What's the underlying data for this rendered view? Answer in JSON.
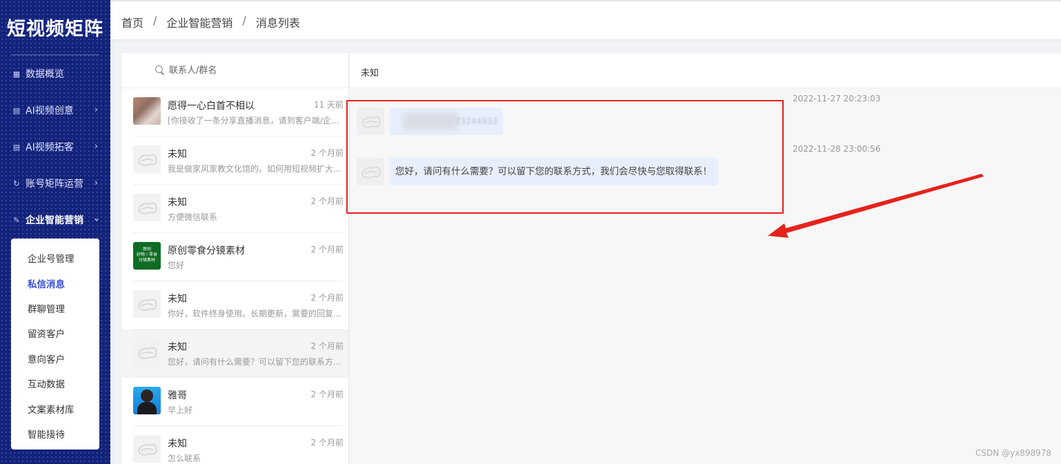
{
  "app": {
    "logo": "短视频矩阵"
  },
  "sidebar": {
    "items": [
      {
        "label": "数据概览",
        "icon": "dashboard-icon",
        "has_children": false
      },
      {
        "label": "AI视频创意",
        "icon": "video-icon",
        "has_children": true
      },
      {
        "label": "AI视频拓客",
        "icon": "video-icon",
        "has_children": true
      },
      {
        "label": "账号矩阵运营",
        "icon": "refresh-icon",
        "has_children": true
      },
      {
        "label": "企业智能营销",
        "icon": "pen-icon",
        "has_children": true,
        "expanded": true
      }
    ],
    "submenu": [
      {
        "label": "企业号管理"
      },
      {
        "label": "私信消息",
        "active": true
      },
      {
        "label": "群聊管理"
      },
      {
        "label": "留资客户"
      },
      {
        "label": "意向客户"
      },
      {
        "label": "互动数据"
      },
      {
        "label": "文案素材库"
      },
      {
        "label": "智能接待"
      }
    ]
  },
  "breadcrumb": [
    "首页",
    "企业智能营销",
    "消息列表"
  ],
  "search": {
    "placeholder": "联系人/群名"
  },
  "contacts": [
    {
      "name": "愿得一心白首不相以",
      "time": "11 天前",
      "preview": "[你接收了一条分享直播消息，请到客户端/企业...",
      "avatar": "photo"
    },
    {
      "name": "未知",
      "time": "2 个月前",
      "preview": "我是做家风家教文化馆的。如何用短视频扩大...",
      "avatar": "default"
    },
    {
      "name": "未知",
      "time": "2 个月前",
      "preview": "方便微信联系",
      "avatar": "default"
    },
    {
      "name": "原创零食分镜素材",
      "time": "2 个月前",
      "preview": "您好",
      "avatar": "green",
      "avatar_text": [
        "原创",
        "好物丨零食",
        "分镜素材"
      ]
    },
    {
      "name": "未知",
      "time": "2 个月前",
      "preview": "你好，软件终身使用。长期更新，需要的回复...",
      "avatar": "default"
    },
    {
      "name": "未知",
      "time": "2 个月前",
      "preview": "您好，请问有什么需要？可以留下您的联系方...",
      "avatar": "default",
      "selected": true
    },
    {
      "name": "雅哥",
      "time": "2 个月前",
      "preview": "早上好",
      "avatar": "blue"
    },
    {
      "name": "未知",
      "time": "2 个月前",
      "preview": "怎么联系",
      "avatar": "default"
    }
  ],
  "chat": {
    "title": "未知",
    "messages": [
      {
        "timestamp": "2022-11-27 20:23:03",
        "text": "73244933",
        "blurred": true
      },
      {
        "timestamp": "2022-11-28 23:00:56",
        "text": "您好，请问有什么需要？可以留下您的联系方式，我们会尽快与您取得联系！",
        "blurred": false
      }
    ]
  },
  "watermark": "CSDN @yx898978",
  "colors": {
    "sidebar_bg": "#14237a",
    "accent": "#3a50d9",
    "annotation_red": "#e5231c",
    "bubble_bg": "#e8eefb"
  }
}
